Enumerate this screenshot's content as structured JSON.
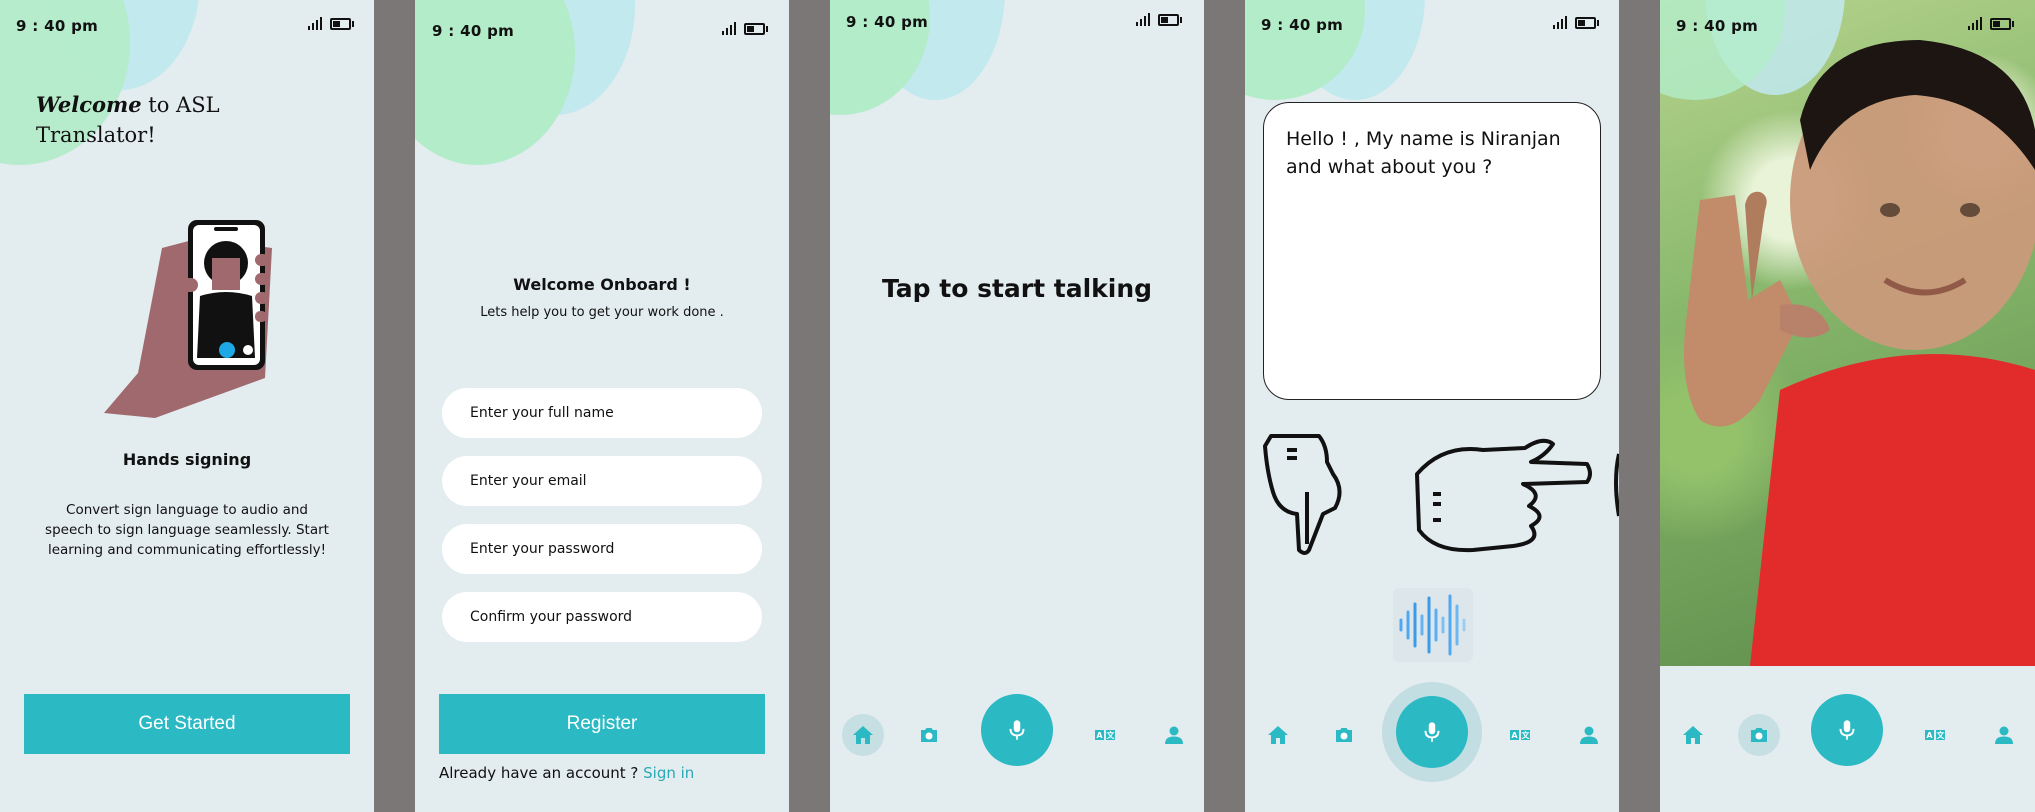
{
  "status_bar": {
    "time": "9 : 40 pm"
  },
  "onboarding": {
    "welcome_bold": "Welcome",
    "welcome_rest": " to ASL",
    "welcome_line2": "Translator!",
    "title": "Hands signing",
    "description": "Convert sign language to audio and speech to sign language seamlessly. Start learning and communicating effortlessly!",
    "button_label": "Get Started"
  },
  "register": {
    "title": "Welcome Onboard !",
    "subtitle": "Lets help you to get your work done .",
    "fields": [
      {
        "placeholder": "Enter your full name"
      },
      {
        "placeholder": "Enter your email"
      },
      {
        "placeholder": "Enter your password"
      },
      {
        "placeholder": "Confirm your password"
      }
    ],
    "button_label": "Register",
    "already_text": "Already have an account ? ",
    "signin_link": "Sign in"
  },
  "talk": {
    "prompt": "Tap to start talking"
  },
  "translation": {
    "text": "Hello ! , My name is Niranjan and what about you ?"
  },
  "nav": {
    "items": [
      "home-icon",
      "camera-icon",
      "mic-icon",
      "translate-icon",
      "profile-icon"
    ]
  },
  "colors": {
    "accent": "#2bb9c3",
    "background": "#e3ecef",
    "blob_green": "#b3ecc9",
    "blob_blue": "#c1e9ee"
  }
}
